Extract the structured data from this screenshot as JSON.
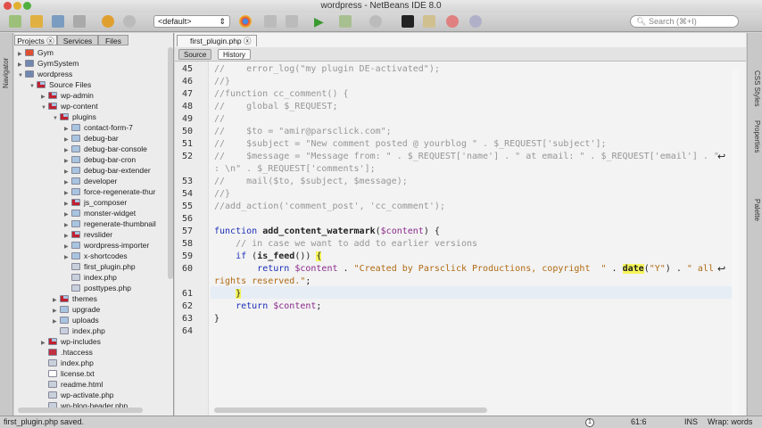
{
  "window": {
    "title": "wordpress - NetBeans IDE 8.0"
  },
  "toolbar": {
    "config_select": "<default>",
    "search_placeholder": "Search (⌘+I)"
  },
  "left_strip": {
    "navigator": "Navigator"
  },
  "projects": {
    "tabs": [
      "Projects",
      "Services",
      "Files"
    ],
    "tree": [
      {
        "label": "Gym",
        "depth": 0,
        "arrow": "right",
        "icon": "html5"
      },
      {
        "label": "GymSystem",
        "depth": 0,
        "arrow": "right",
        "icon": "php-project"
      },
      {
        "label": "wordpress",
        "depth": 0,
        "arrow": "down",
        "icon": "php-project"
      },
      {
        "label": "Source Files",
        "depth": 1,
        "arrow": "down",
        "icon": "folder-lock"
      },
      {
        "label": "wp-admin",
        "depth": 2,
        "arrow": "right",
        "icon": "folder-lock"
      },
      {
        "label": "wp-content",
        "depth": 2,
        "arrow": "down",
        "icon": "folder-lock"
      },
      {
        "label": "plugins",
        "depth": 3,
        "arrow": "down",
        "icon": "folder-lock"
      },
      {
        "label": "contact-form-7",
        "depth": 4,
        "arrow": "right",
        "icon": "folder"
      },
      {
        "label": "debug-bar",
        "depth": 4,
        "arrow": "right",
        "icon": "folder"
      },
      {
        "label": "debug-bar-console",
        "depth": 4,
        "arrow": "right",
        "icon": "folder"
      },
      {
        "label": "debug-bar-cron",
        "depth": 4,
        "arrow": "right",
        "icon": "folder"
      },
      {
        "label": "debug-bar-extender",
        "depth": 4,
        "arrow": "right",
        "icon": "folder"
      },
      {
        "label": "developer",
        "depth": 4,
        "arrow": "right",
        "icon": "folder"
      },
      {
        "label": "force-regenerate-thur",
        "depth": 4,
        "arrow": "right",
        "icon": "folder"
      },
      {
        "label": "js_composer",
        "depth": 4,
        "arrow": "right",
        "icon": "folder-lock"
      },
      {
        "label": "monster-widget",
        "depth": 4,
        "arrow": "right",
        "icon": "folder"
      },
      {
        "label": "regenerate-thumbnail",
        "depth": 4,
        "arrow": "right",
        "icon": "folder"
      },
      {
        "label": "revslider",
        "depth": 4,
        "arrow": "right",
        "icon": "folder-lock"
      },
      {
        "label": "wordpress-importer",
        "depth": 4,
        "arrow": "right",
        "icon": "folder"
      },
      {
        "label": "x-shortcodes",
        "depth": 4,
        "arrow": "right",
        "icon": "folder"
      },
      {
        "label": "first_plugin.php",
        "depth": 4,
        "arrow": "",
        "icon": "php-file"
      },
      {
        "label": "index.php",
        "depth": 4,
        "arrow": "",
        "icon": "php-file"
      },
      {
        "label": "posttypes.php",
        "depth": 4,
        "arrow": "",
        "icon": "php-file"
      },
      {
        "label": "themes",
        "depth": 3,
        "arrow": "right",
        "icon": "folder-lock"
      },
      {
        "label": "upgrade",
        "depth": 3,
        "arrow": "right",
        "icon": "folder"
      },
      {
        "label": "uploads",
        "depth": 3,
        "arrow": "right",
        "icon": "folder"
      },
      {
        "label": "index.php",
        "depth": 3,
        "arrow": "",
        "icon": "php-file"
      },
      {
        "label": "wp-includes",
        "depth": 2,
        "arrow": "right",
        "icon": "folder-lock"
      },
      {
        "label": ".htaccess",
        "depth": 2,
        "arrow": "",
        "icon": "htaccess-file"
      },
      {
        "label": "index.php",
        "depth": 2,
        "arrow": "",
        "icon": "php-file"
      },
      {
        "label": "license.txt",
        "depth": 2,
        "arrow": "",
        "icon": "text-file"
      },
      {
        "label": "readme.html",
        "depth": 2,
        "arrow": "",
        "icon": "html-file"
      },
      {
        "label": "wp-activate.php",
        "depth": 2,
        "arrow": "",
        "icon": "php-file"
      },
      {
        "label": "wp-blog-header.php",
        "depth": 2,
        "arrow": "",
        "icon": "php-file"
      }
    ]
  },
  "editor": {
    "tab": "first_plugin.php",
    "source_label": "Source",
    "history_label": "History",
    "lines": [
      {
        "n": "45",
        "segs": [
          [
            "c",
            "//    error_log(\"my plugin DE-activated\");"
          ]
        ]
      },
      {
        "n": "46",
        "segs": [
          [
            "c",
            "//}"
          ]
        ]
      },
      {
        "n": "47",
        "segs": [
          [
            "c",
            "//function cc_comment() {"
          ]
        ]
      },
      {
        "n": "48",
        "segs": [
          [
            "c",
            "//    global $_REQUEST;"
          ]
        ]
      },
      {
        "n": "49",
        "segs": [
          [
            "c",
            "//"
          ]
        ]
      },
      {
        "n": "50",
        "segs": [
          [
            "c",
            "//    $to = \"amir@parsclick.com\";"
          ]
        ]
      },
      {
        "n": "51",
        "segs": [
          [
            "c",
            "//    $subject = \"New comment posted @ yourblog \" . $_REQUEST['subject'];"
          ]
        ]
      },
      {
        "n": "52",
        "segs": [
          [
            "c",
            "//    $message = \"Message from: \" . $_REQUEST['name'] . \" at email: \" . $_REQUEST['email'] . \""
          ]
        ],
        "wrap": [
          [
            "c",
            ": \\n\" . $_REQUEST['comments'];"
          ]
        ]
      },
      {
        "n": "53",
        "segs": [
          [
            "c",
            "//    mail($to, $subject, $message);"
          ]
        ]
      },
      {
        "n": "54",
        "segs": [
          [
            "c",
            "//}"
          ]
        ]
      },
      {
        "n": "55",
        "segs": [
          [
            "c",
            "//add_action('comment_post', 'cc_comment');"
          ]
        ]
      },
      {
        "n": "56",
        "segs": []
      },
      {
        "n": "57",
        "segs": [
          [
            "k",
            "function "
          ],
          [
            "b",
            "add_content_watermark"
          ],
          [
            "",
            "("
          ],
          [
            "v",
            "$content"
          ],
          [
            "",
            ") {"
          ]
        ]
      },
      {
        "n": "58",
        "segs": [
          [
            "c",
            "    // in case we want to add to earlier versions"
          ]
        ]
      },
      {
        "n": "59",
        "segs": [
          [
            "",
            "    "
          ],
          [
            "k",
            "if"
          ],
          [
            "",
            " ("
          ],
          [
            "b",
            "is_feed"
          ],
          [
            "",
            "()) "
          ],
          [
            "hl",
            "{"
          ]
        ]
      },
      {
        "n": "60",
        "segs": [
          [
            "",
            "        "
          ],
          [
            "k",
            "return "
          ],
          [
            "v",
            "$content"
          ],
          [
            "",
            " . "
          ],
          [
            "s",
            "\"Created by Parsclick Productions, copyright  \""
          ],
          [
            "",
            " . "
          ],
          [
            "b hl",
            "date"
          ],
          [
            "",
            "("
          ],
          [
            "s",
            "\"Y\""
          ],
          [
            "",
            ") . "
          ],
          [
            "s",
            "\" all"
          ]
        ],
        "wrap": [
          [
            "s",
            "rights reserved.\""
          ],
          [
            "",
            ";"
          ]
        ]
      },
      {
        "n": "61",
        "segs": [
          [
            "",
            "    "
          ],
          [
            "hl",
            "}"
          ]
        ]
      },
      {
        "n": "62",
        "segs": [
          [
            "",
            "    "
          ],
          [
            "k",
            "return "
          ],
          [
            "v",
            "$content"
          ],
          [
            "",
            ";"
          ]
        ]
      },
      {
        "n": "63",
        "segs": [
          [
            "",
            "}"
          ]
        ]
      },
      {
        "n": "64",
        "segs": []
      }
    ]
  },
  "right_strip": {
    "items": [
      "CSS Styles",
      "Properties",
      "Palette"
    ]
  },
  "status": {
    "message": "first_plugin.php saved.",
    "notifications": "1",
    "position": "61:6",
    "mode": "INS",
    "wrap": "Wrap: words"
  }
}
